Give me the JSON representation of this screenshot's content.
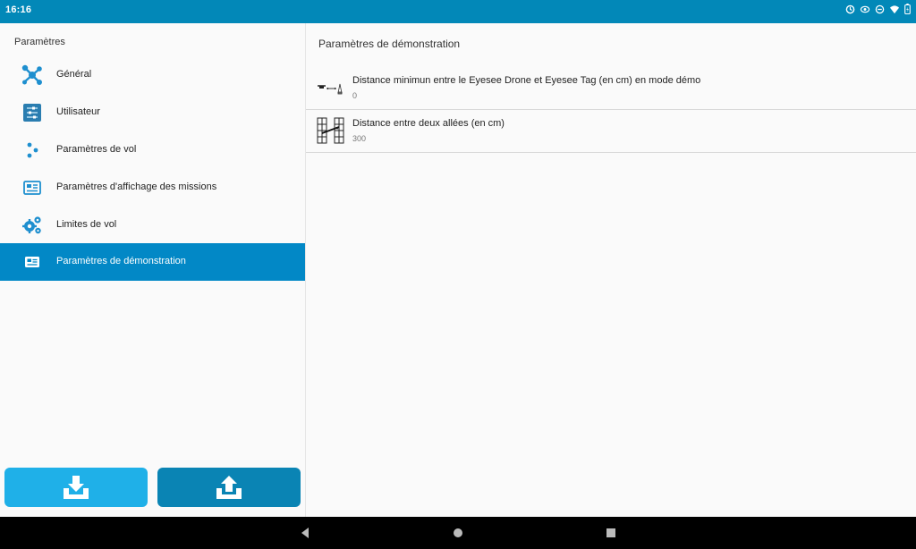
{
  "status_bar": {
    "time": "16:16",
    "icons": [
      "sync-icon",
      "eye-icon",
      "dnd-icon",
      "wifi-icon",
      "battery-icon"
    ]
  },
  "left_pane": {
    "title": "Paramètres",
    "items": [
      {
        "label": "Général",
        "icon": "molecule-icon"
      },
      {
        "label": "Utilisateur",
        "icon": "sliders-icon"
      },
      {
        "label": "Paramètres de vol",
        "icon": "dots-icon"
      },
      {
        "label": "Paramètres d'affichage des missions",
        "icon": "card-icon"
      },
      {
        "label": "Limites de vol",
        "icon": "gears-icon"
      },
      {
        "label": "Paramètres de démonstration",
        "icon": "card-icon",
        "active": true
      }
    ],
    "buttons": {
      "download": "download-icon",
      "upload": "upload-icon"
    }
  },
  "right_pane": {
    "title": "Paramètres de démonstration",
    "rows": [
      {
        "title": "Distance minimun entre le Eyesee Drone et Eyesee Tag (en cm) en mode démo",
        "summary": "0",
        "icon": "drone-distance-icon"
      },
      {
        "title": "Distance entre deux allées (en cm)",
        "summary": "300",
        "icon": "aisle-distance-icon"
      }
    ]
  },
  "colors": {
    "accent": "#0288c6",
    "status_bar": "#0288b8",
    "download_btn": "#1fb0e8",
    "upload_btn": "#0a84b4"
  }
}
